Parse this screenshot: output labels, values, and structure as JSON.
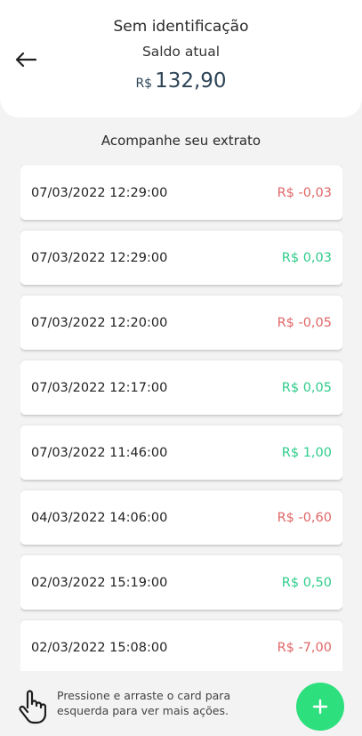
{
  "header": {
    "title": "Sem identificação",
    "subtitle": "Saldo atual",
    "balance_currency": "R$",
    "balance_value": "132,90"
  },
  "section_title": "Acompanhe seu extrato",
  "transactions": [
    {
      "date": "07/03/2022 12:29:00",
      "amount": "R$ -0,03",
      "type": "negative"
    },
    {
      "date": "07/03/2022 12:29:00",
      "amount": "R$ 0,03",
      "type": "positive"
    },
    {
      "date": "07/03/2022 12:20:00",
      "amount": "R$ -0,05",
      "type": "negative"
    },
    {
      "date": "07/03/2022 12:17:00",
      "amount": "R$ 0,05",
      "type": "positive"
    },
    {
      "date": "07/03/2022 11:46:00",
      "amount": "R$ 1,00",
      "type": "positive"
    },
    {
      "date": "04/03/2022 14:06:00",
      "amount": "R$ -0,60",
      "type": "negative"
    },
    {
      "date": "02/03/2022 15:19:00",
      "amount": "R$ 0,50",
      "type": "positive"
    },
    {
      "date": "02/03/2022 15:08:00",
      "amount": "R$ -7,00",
      "type": "negative"
    }
  ],
  "footer": {
    "hint": "Pressione e arraste o card para esquerda para ver mais ações.",
    "hand_icon": "hand-pointer-icon",
    "fab_icon": "plus-icon"
  },
  "colors": {
    "positive": "#2ecc8a",
    "negative": "#e06666",
    "fab": "#2ee07d",
    "balance": "#2d4456"
  }
}
